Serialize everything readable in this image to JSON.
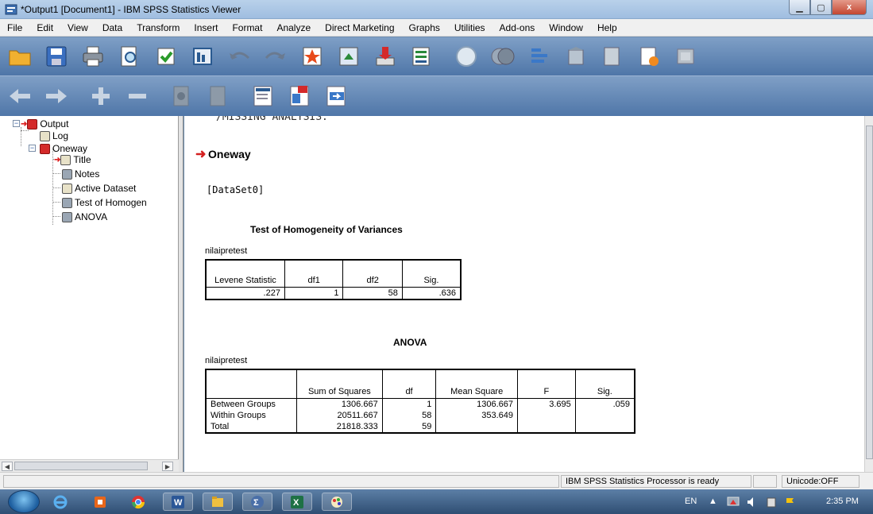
{
  "window": {
    "title": "*Output1 [Document1] - IBM SPSS Statistics Viewer",
    "minimize_icon": "minimize-icon",
    "maximize_icon": "maximize-icon",
    "close_label": "x"
  },
  "menu": [
    "File",
    "Edit",
    "View",
    "Data",
    "Transform",
    "Insert",
    "Format",
    "Analyze",
    "Direct Marketing",
    "Graphs",
    "Utilities",
    "Add-ons",
    "Window",
    "Help"
  ],
  "toolbar1_icons": [
    "open-icon",
    "save-icon",
    "print-icon",
    "print-preview-icon",
    "export-icon",
    "recall-dialog-icon",
    "undo-icon",
    "redo-icon",
    "goto-data-icon",
    "goto-variable-icon",
    "variables-icon",
    "select-cases-icon",
    "value-labels-icon",
    "use-sets-icon",
    "show-all-icon",
    "designate-window-icon",
    "run-script-icon",
    "output-icon",
    "chart-icon",
    "table-icon"
  ],
  "toolbar2_icons": [
    "promote-icon",
    "demote-icon",
    "expand-icon",
    "collapse-icon",
    "show-icon",
    "hide-icon",
    "insert-heading-icon",
    "insert-title-icon",
    "insert-text-icon"
  ],
  "outline": {
    "root": "Output",
    "log": "Log",
    "oneway": "Oneway",
    "children": [
      "Title",
      "Notes",
      "Active Dataset",
      "Test of Homogen",
      "ANOVA"
    ]
  },
  "content": {
    "cut_text": "/MISSING ANALYSIS.",
    "heading": "Oneway",
    "dataset": "[DataSet0]",
    "homogeneity": {
      "title": "Test of Homogeneity of Variances",
      "caption": "nilaipretest",
      "headers": [
        "Levene Statistic",
        "df1",
        "df2",
        "Sig."
      ],
      "values": [
        ".227",
        "1",
        "58",
        ".636"
      ]
    },
    "anova": {
      "title": "ANOVA",
      "caption": "nilaipretest",
      "headers": [
        "",
        "Sum of Squares",
        "df",
        "Mean Square",
        "F",
        "Sig."
      ],
      "rows": [
        [
          "Between Groups",
          "1306.667",
          "1",
          "1306.667",
          "3.695",
          ".059"
        ],
        [
          "Within Groups",
          "20511.667",
          "58",
          "353.649",
          "",
          ""
        ],
        [
          "Total",
          "21818.333",
          "59",
          "",
          "",
          ""
        ]
      ]
    }
  },
  "status": {
    "processor": "IBM SPSS Statistics Processor is ready",
    "unicode": "Unicode:OFF"
  },
  "taskbar": {
    "apps": [
      "ie-icon",
      "office-icon",
      "chrome-icon",
      "word-icon",
      "explorer-icon",
      "spss-icon",
      "excel-icon",
      "paint-icon"
    ],
    "lang": "EN",
    "time": "2:35 PM"
  }
}
